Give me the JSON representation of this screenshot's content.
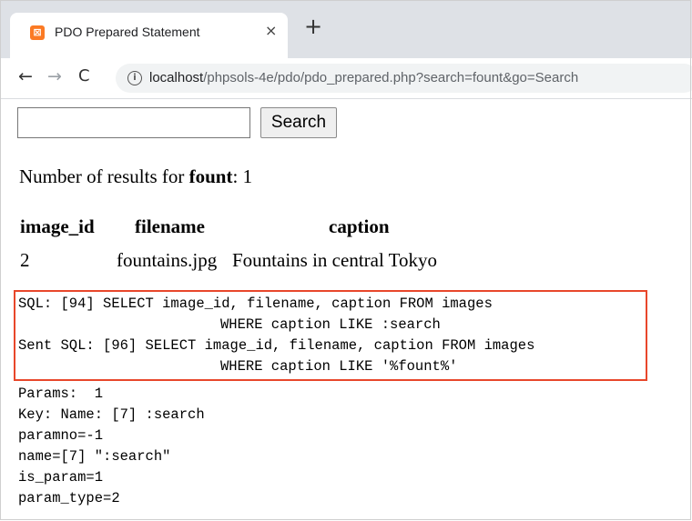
{
  "browser": {
    "tab": {
      "title": "PDO Prepared Statement",
      "favicon": "xampp-icon",
      "close": "×"
    },
    "new_tab": "+",
    "url_host": "localhost",
    "url_path": "/phpsols-4e/pdo/pdo_prepared.php?search=fount&go=Search"
  },
  "form": {
    "search_value": "",
    "search_button": "Search"
  },
  "results": {
    "prefix": "Number of results for ",
    "term": "fount",
    "suffix": ": 1"
  },
  "table": {
    "headers": [
      "image_id",
      "filename",
      "caption"
    ],
    "rows": [
      {
        "image_id": "2",
        "filename": "fountains.jpg",
        "caption": "Fountains in central Tokyo"
      }
    ]
  },
  "debug": {
    "sql_line1": "SQL: [94] SELECT image_id, filename, caption FROM images",
    "sql_line2": "WHERE caption LIKE :search",
    "sent_line1": "Sent SQL: [96] SELECT image_id, filename, caption FROM images",
    "sent_line2": "WHERE caption LIKE '%fount%'",
    "params": "Params:  1",
    "key": "Key: Name: [7] :search",
    "paramno": "paramno=-1",
    "name": "name=[7] \":search\"",
    "is_param": "is_param=1",
    "param_type": "param_type=2"
  },
  "colors": {
    "highlight": "#e8472b",
    "tabstrip": "#dee1e6",
    "favicon": "#fb7a24"
  }
}
